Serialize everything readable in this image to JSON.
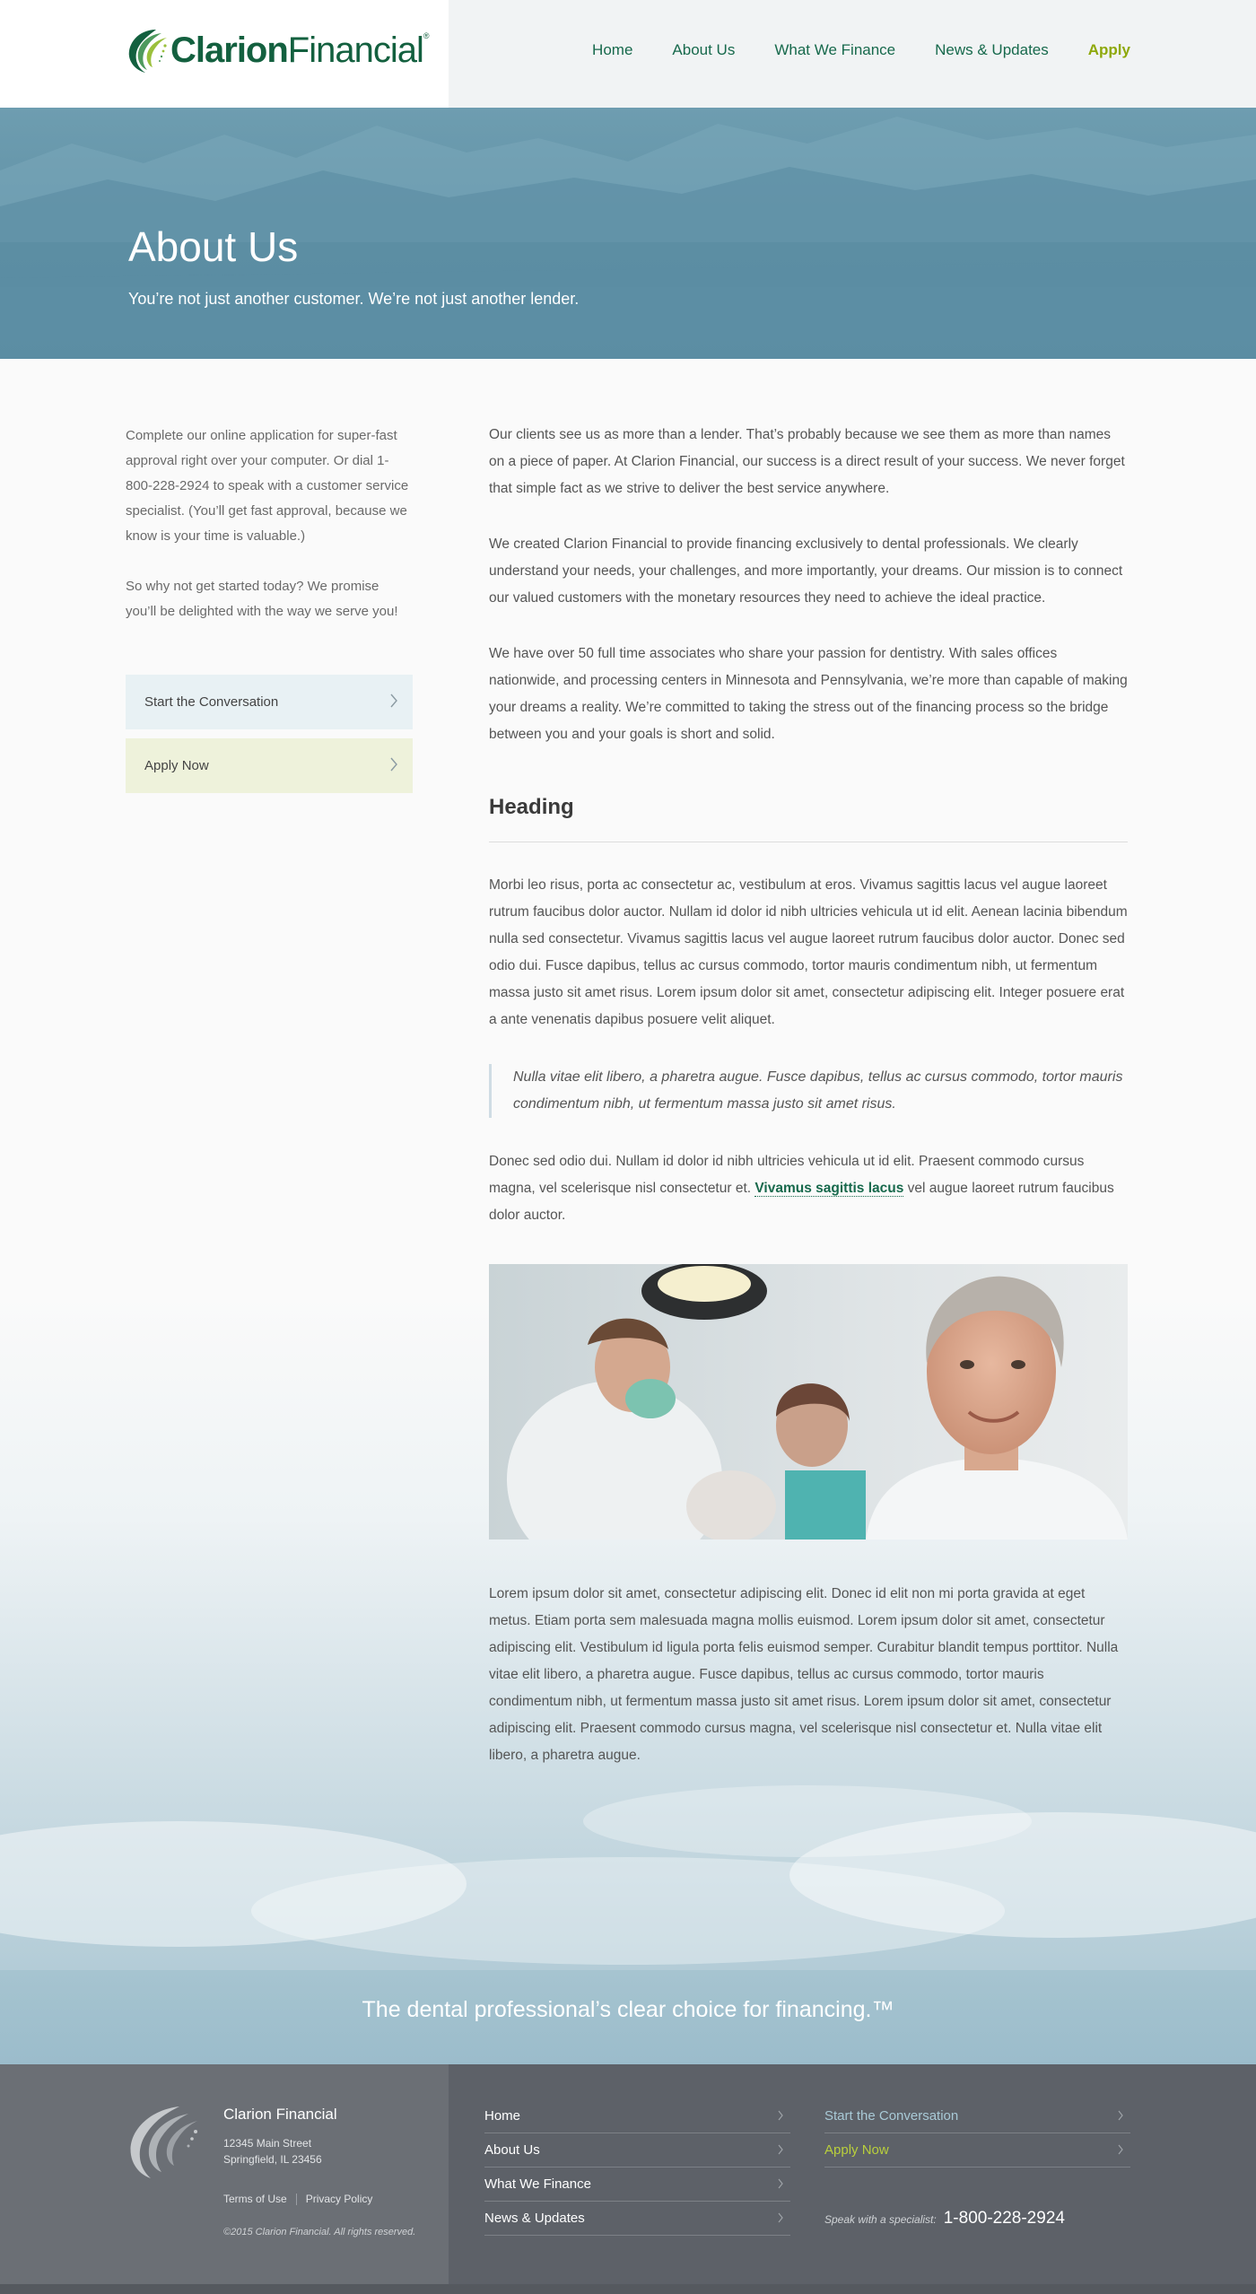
{
  "brand": {
    "name_bold": "Clarion",
    "name_light": "Financial",
    "trademark": "®"
  },
  "nav": {
    "items": [
      "Home",
      "About Us",
      "What We Finance",
      "News & Updates"
    ],
    "apply": "Apply"
  },
  "hero": {
    "title": "About Us",
    "subtitle": "You’re not just another customer. We’re not just another lender."
  },
  "sidebar": {
    "p1": "Complete our online application for super-fast approval right over your computer. Or dial 1-800-228-2924 to speak with a customer service specialist. (You’ll get fast approval, because we know is your time is valuable.)",
    "p2": "So why not get started today? We promise you’ll be delighted with the way we serve you!",
    "cta_conversation": "Start the Conversation",
    "cta_apply": "Apply Now"
  },
  "content": {
    "p1": "Our clients see us as more than a lender. That’s probably because we see them as more than names on a piece of paper. At Clarion Financial, our success is a direct result of your success. We never forget that simple fact as we strive to deliver the best service anywhere.",
    "p2": "We created Clarion Financial to provide financing exclusively to dental professionals. We clearly understand your needs, your challenges, and more importantly, your dreams. Our mission is to connect our valued customers with the monetary resources they need to achieve the ideal practice.",
    "p3": "We have over 50 full time associates who share your passion for dentistry. With sales offices nationwide, and processing centers in Minnesota and Pennsylvania, we’re more than capable of making your dreams a reality. We’re committed to taking the stress out of the financing process so the bridge between you and your goals is short and solid.",
    "heading": "Heading",
    "p4": "Morbi leo risus, porta ac consectetur ac, vestibulum at eros. Vivamus sagittis lacus vel augue laoreet rutrum faucibus dolor auctor. Nullam id dolor id nibh ultricies vehicula ut id elit. Aenean lacinia bibendum nulla sed consectetur. Vivamus sagittis lacus vel augue laoreet rutrum faucibus dolor auctor. Donec sed odio dui. Fusce dapibus, tellus ac cursus commodo, tortor mauris condimentum nibh, ut fermentum massa justo sit amet risus. Lorem ipsum dolor sit amet, consectetur adipiscing elit. Integer posuere erat a ante venenatis dapibus posuere velit aliquet.",
    "quote": "Nulla vitae elit libero, a pharetra augue. Fusce dapibus, tellus ac cursus commodo, tortor mauris condimentum nibh, ut fermentum massa justo sit amet risus.",
    "p5_before": "Donec sed odio dui. Nullam id dolor id nibh ultricies vehicula ut id elit. Praesent commodo cursus magna, vel scelerisque nisl consectetur et. ",
    "p5_link": "Vivamus sagittis lacus",
    "p5_after": " vel augue laoreet rutrum faucibus dolor auctor.",
    "p6": "Lorem ipsum dolor sit amet, consectetur adipiscing elit. Donec id elit non mi porta gravida at eget metus. Etiam porta sem malesuada magna mollis euismod. Lorem ipsum dolor sit amet, consectetur adipiscing elit. Vestibulum id ligula porta felis euismod semper. Curabitur blandit tempus porttitor. Nulla vitae elit libero, a pharetra augue. Fusce dapibus, tellus ac cursus commodo, tortor mauris condimentum nibh, ut fermentum massa justo sit amet risus. Lorem ipsum dolor sit amet, consectetur adipiscing elit. Praesent commodo cursus magna, vel scelerisque nisl consectetur et. Nulla vitae elit libero, a pharetra augue."
  },
  "tagline": "The dental professional’s clear choice for financing.™",
  "footer": {
    "company": "Clarion Financial",
    "address1": "12345 Main Street",
    "address2": "Springfield, IL 23456",
    "terms": "Terms of Use",
    "privacy": "Privacy Policy",
    "copyright": "©2015 Clarion Financial. All rights reserved.",
    "nav": [
      "Home",
      "About Us",
      "What We Finance",
      "News & Updates"
    ],
    "cta_conversation": "Start the Conversation",
    "cta_apply": "Apply Now",
    "speak_label": "Speak with a specialist:",
    "phone": "1-800-228-2924"
  },
  "colors": {
    "brand_green": "#13603f",
    "accent_lime": "#8ea80a",
    "hero_blue": "#5f91a6",
    "footer_gray": "#5d6168"
  }
}
